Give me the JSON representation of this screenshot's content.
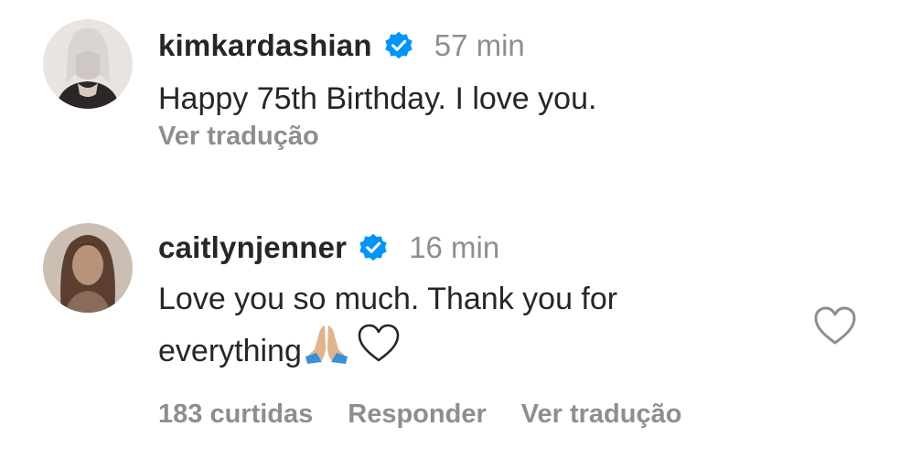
{
  "comments": [
    {
      "username": "kimkardashian",
      "verified": true,
      "time": "57 min",
      "text": "Happy 75th Birthday. I love you.",
      "translate_label": "Ver tradução"
    },
    {
      "username": "caitlynjenner",
      "verified": true,
      "time": "16 min",
      "text_line1": "Love you so much. Thank you for",
      "text_line2": "everything",
      "emojis": [
        "folded-hands-emoji",
        "white-heart-emoji"
      ],
      "likes_label": "183 curtidas",
      "reply_label": "Responder",
      "translate_label": "Ver tradução",
      "like_icon": "heart-outline-icon"
    }
  ],
  "colors": {
    "text": "#262626",
    "secondary": "#8e8e8e",
    "verified_blue": "#0095f6"
  }
}
